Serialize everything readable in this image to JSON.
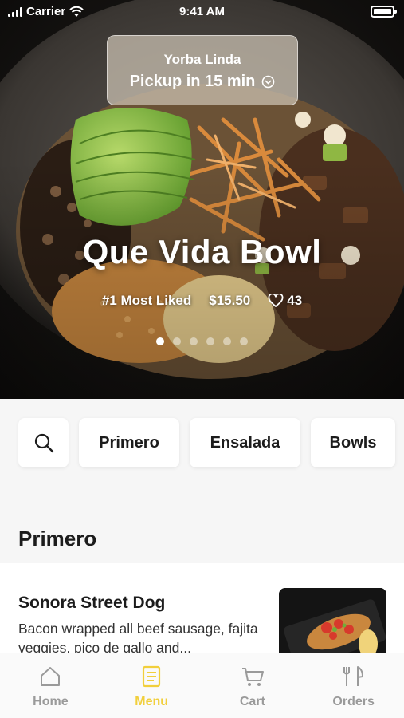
{
  "status_bar": {
    "carrier": "Carrier",
    "time": "9:41 AM"
  },
  "pickup": {
    "location": "Yorba Linda",
    "eta": "Pickup in 15 min"
  },
  "hero": {
    "title": "Que Vida Bowl",
    "badge": "#1 Most Liked",
    "price": "$15.50",
    "likes": "43",
    "carousel": {
      "count": 6,
      "active": 1
    }
  },
  "categories": {
    "search_icon": "search-icon",
    "items": [
      "Primero",
      "Ensalada",
      "Bowls"
    ]
  },
  "section": {
    "title": "Primero"
  },
  "menu_items": [
    {
      "name": "Sonora Street Dog",
      "description": "Bacon wrapped all beef sausage, fajita veggies, pico de gallo and..."
    }
  ],
  "tabs": [
    {
      "label": "Home",
      "icon": "home-icon"
    },
    {
      "label": "Menu",
      "icon": "menu-icon",
      "active": true
    },
    {
      "label": "Cart",
      "icon": "cart-icon"
    },
    {
      "label": "Orders",
      "icon": "orders-icon"
    }
  ],
  "colors": {
    "accent": "#f1cf3c",
    "inactive_tab": "#9a9a9a"
  }
}
